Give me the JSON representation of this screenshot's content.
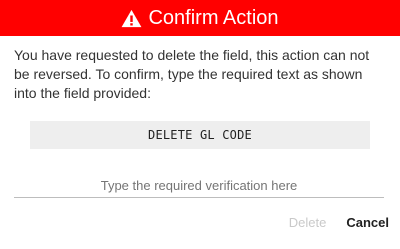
{
  "header": {
    "title": "Confirm Action",
    "icon": "warning-icon",
    "background": "#ff0000"
  },
  "body": {
    "message": "You have requested to delete the field, this action can not be reversed. To confirm, type the required text as shown into the field provided:",
    "required_text": "DELETE GL CODE"
  },
  "verification": {
    "value": "",
    "placeholder": "Type the required verification here"
  },
  "actions": {
    "delete_label": "Delete",
    "cancel_label": "Cancel",
    "delete_enabled": false
  }
}
